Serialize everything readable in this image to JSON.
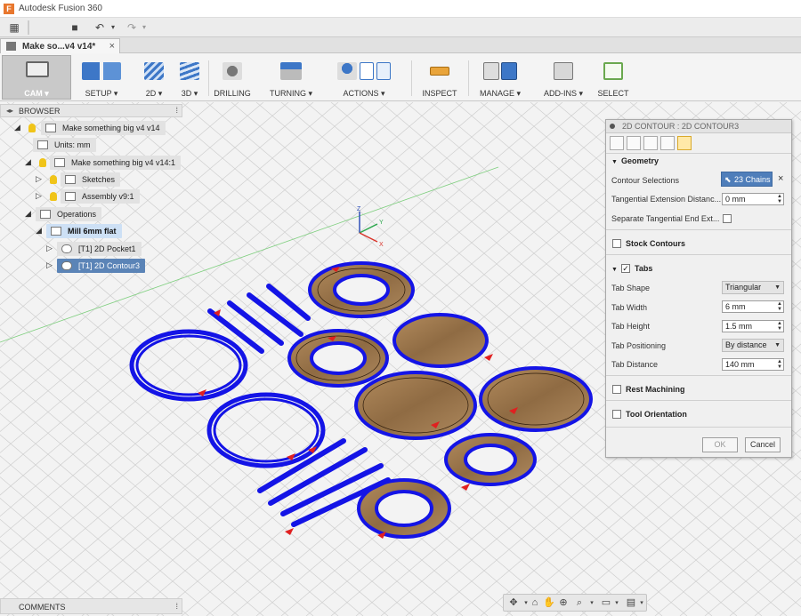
{
  "window": {
    "title": "Autodesk Fusion 360",
    "app_icon": "F"
  },
  "qat": {
    "grid": "▦",
    "save": "■",
    "undo": "↶",
    "redo": "↷"
  },
  "document_tab": {
    "label": "Make so...v4 v14*",
    "close": "×"
  },
  "ribbon": {
    "workspace": "CAM ▾",
    "groups": [
      {
        "label": "SETUP ▾",
        "icon": "setup-icon",
        "color": "#3d77c7"
      },
      {
        "label": "2D ▾",
        "icon": "2d-icon",
        "color": "#3d77c7"
      },
      {
        "label": "3D ▾",
        "icon": "3d-icon",
        "color": "#3d77c7"
      },
      {
        "label": "DRILLING",
        "icon": "drilling-icon",
        "color": "#555555"
      },
      {
        "label": "TURNING ▾",
        "icon": "turning-icon",
        "color": "#3d77c7"
      },
      {
        "label": "ACTIONS ▾",
        "icon": "actions-icon",
        "color": "#3d77c7"
      },
      {
        "label": "INSPECT",
        "icon": "inspect-icon",
        "color": "#e9a43a"
      },
      {
        "label": "MANAGE ▾",
        "icon": "manage-icon",
        "color": "#3d77c7"
      },
      {
        "label": "ADD-INS ▾",
        "icon": "addins-icon",
        "color": "#555555"
      },
      {
        "label": "SELECT",
        "icon": "select-icon",
        "color": "#6aa84f"
      }
    ],
    "actions_small": [
      "G1",
      "G2"
    ]
  },
  "browser": {
    "title": "BROWSER",
    "items": [
      {
        "label": "Make something big v4 v14"
      },
      {
        "label": "Units: mm"
      },
      {
        "label": "Make something big v4 v14:1"
      },
      {
        "label": "Sketches"
      },
      {
        "label": "Assembly v9:1"
      },
      {
        "label": "Operations"
      },
      {
        "label": "Mill 6mm flat"
      },
      {
        "label": "[T1] 2D Pocket1"
      },
      {
        "label": "[T1] 2D Contour3"
      }
    ]
  },
  "comments": {
    "title": "COMMENTS"
  },
  "viewcube": {
    "z": "Z",
    "y": "Y",
    "x": "X"
  },
  "panel": {
    "title": "2D CONTOUR : 2D CONTOUR3",
    "geometry": {
      "heading": "Geometry",
      "contour_selections_label": "Contour Selections",
      "contour_selections_value": "23 Chains",
      "clear": "×",
      "tangential_extension_label": "Tangential Extension Distanc...",
      "tangential_extension_value": "0 mm",
      "separate_tangential_label": "Separate Tangential End Ext..."
    },
    "stock_contours": "Stock Contours",
    "tabs": {
      "heading": "Tabs",
      "tab_shape_label": "Tab Shape",
      "tab_shape_value": "Triangular",
      "tab_width_label": "Tab Width",
      "tab_width_value": "6 mm",
      "tab_height_label": "Tab Height",
      "tab_height_value": "1.5 mm",
      "tab_positioning_label": "Tab Positioning",
      "tab_positioning_value": "By distance",
      "tab_distance_label": "Tab Distance",
      "tab_distance_value": "140 mm"
    },
    "rest_machining": "Rest Machining",
    "tool_orientation": "Tool Orientation",
    "ok": "OK",
    "cancel": "Cancel"
  },
  "navbar": {
    "icons": [
      "orbit-icon",
      "look-at-icon",
      "pan-icon",
      "zoom-icon",
      "fit-icon",
      "display-icon",
      "grid-icon"
    ]
  },
  "colors": {
    "toolpath": "#1414e6",
    "wood": "#a07c52",
    "tab_marker": "#e02020",
    "selection": "#4f7eba"
  }
}
